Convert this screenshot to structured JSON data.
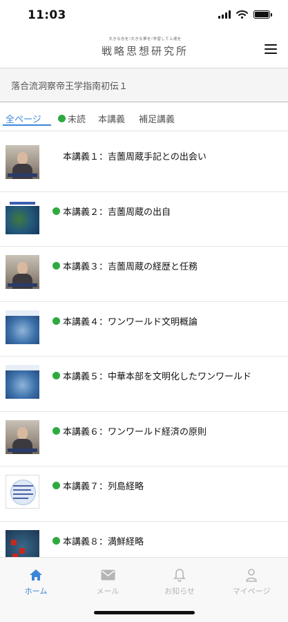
{
  "status_bar": {
    "time": "11:03"
  },
  "header": {
    "logo_tagline": "大きな志を!大きな夢を!学習して上達を",
    "logo_title": "戦略思想研究所"
  },
  "course": {
    "title": "落合流洞察帝王学指南初伝１"
  },
  "filter_tabs": {
    "all": "全ページ",
    "unread": "未読",
    "main": "本講義",
    "supplement": "補足講義"
  },
  "lectures": [
    {
      "title": "本講義１：吉薗周蔵手記との出会い",
      "unread": false,
      "thumb": "person-icon"
    },
    {
      "title": "本講義２：吉薗周蔵の出自",
      "unread": true,
      "thumb": "map-icon"
    },
    {
      "title": "本講義３：吉薗周蔵の経歴と任務",
      "unread": true,
      "thumb": "person-icon"
    },
    {
      "title": "本講義４：ワンワールド文明概論",
      "unread": true,
      "thumb": "globe-icon"
    },
    {
      "title": "本講義５：中華本部を文明化したワンワールド",
      "unread": true,
      "thumb": "globe-icon"
    },
    {
      "title": "本講義６：ワンワールド経済の原則",
      "unread": true,
      "thumb": "person-icon"
    },
    {
      "title": "本講義７：列島経略",
      "unread": true,
      "thumb": "document-icon"
    },
    {
      "title": "本講義８：満鮮経略",
      "unread": true,
      "thumb": "map-icon"
    }
  ],
  "tab_bar": {
    "home": "ホーム",
    "mail": "メール",
    "notice": "お知らせ",
    "mypage": "マイページ"
  },
  "colors": {
    "accent": "#3a86d8",
    "unread_dot": "#2eaa3f",
    "inactive": "#b5b5b5"
  }
}
